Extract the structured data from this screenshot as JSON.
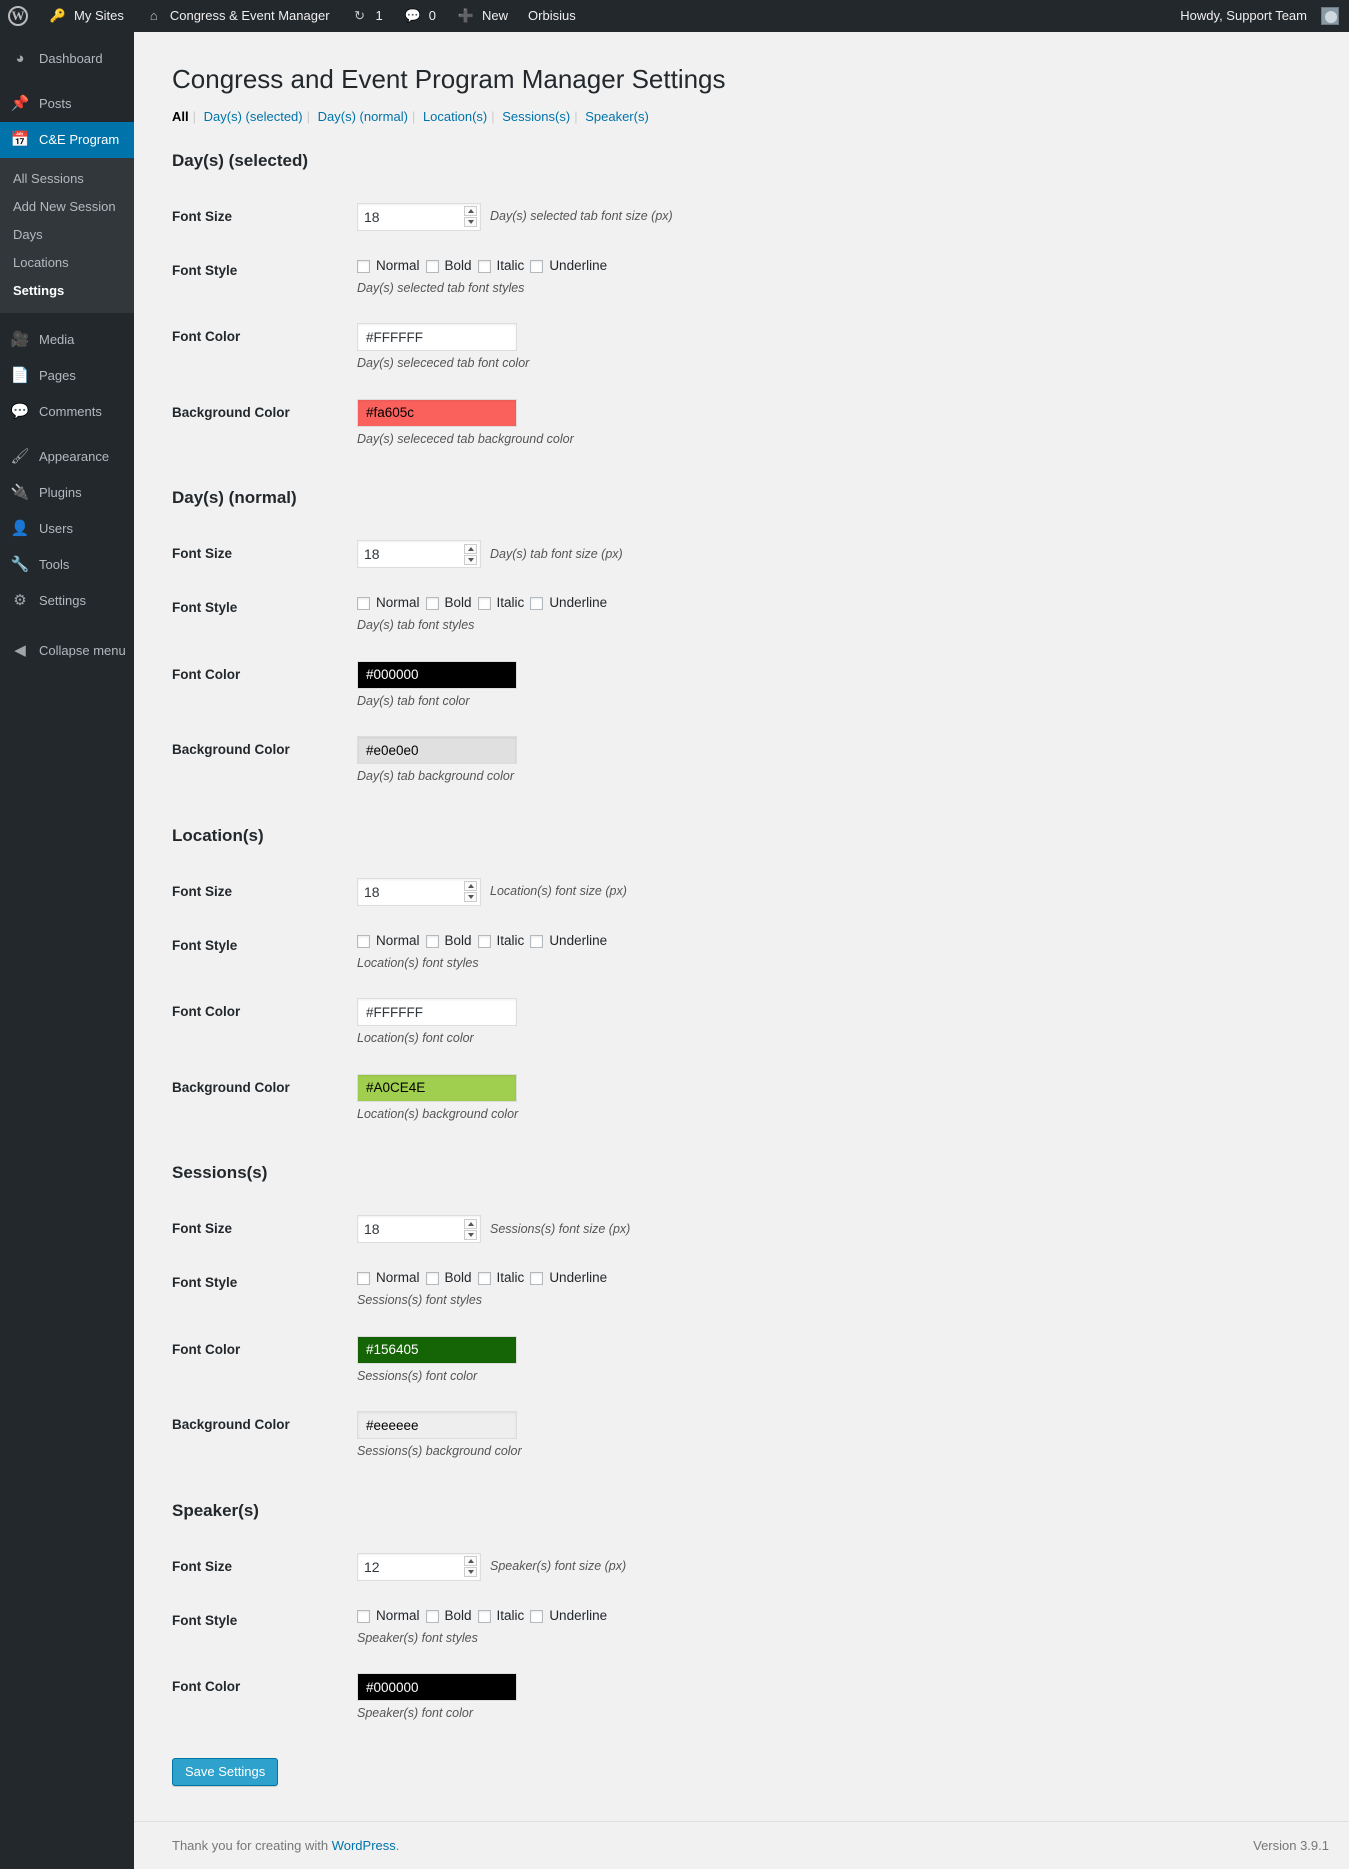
{
  "adminbar": {
    "logo_icon": "wordpress-logo-icon",
    "items": [
      {
        "icon": "key-icon",
        "label": "My Sites"
      },
      {
        "icon": "home-icon",
        "label": "Congress & Event Manager"
      },
      {
        "icon": "updates-icon",
        "label": "1"
      },
      {
        "icon": "comment-bubble-icon",
        "label": "0"
      },
      {
        "icon": "plus-icon",
        "label": "New"
      },
      {
        "icon": "",
        "label": "Orbisius"
      }
    ],
    "howdy": "Howdy, Support Team"
  },
  "sidebar": {
    "items": [
      {
        "icon": "dashboard-icon",
        "label": "Dashboard",
        "current": false
      },
      {
        "icon": "pin-icon",
        "label": "Posts",
        "current": false
      },
      {
        "icon": "calendar-icon",
        "label": "C&E Program",
        "current": true
      },
      {
        "icon": "media-icon",
        "label": "Media",
        "current": false
      },
      {
        "icon": "pages-icon",
        "label": "Pages",
        "current": false
      },
      {
        "icon": "comments-icon",
        "label": "Comments",
        "current": false
      },
      {
        "icon": "appearance-icon",
        "label": "Appearance",
        "current": false
      },
      {
        "icon": "plugins-icon",
        "label": "Plugins",
        "current": false
      },
      {
        "icon": "users-icon",
        "label": "Users",
        "current": false
      },
      {
        "icon": "tools-icon",
        "label": "Tools",
        "current": false
      },
      {
        "icon": "settings-icon",
        "label": "Settings",
        "current": false
      },
      {
        "icon": "collapse-icon",
        "label": "Collapse menu",
        "current": false
      }
    ],
    "submenu": [
      {
        "label": "All Sessions",
        "current": false
      },
      {
        "label": "Add New Session",
        "current": false
      },
      {
        "label": "Days",
        "current": false
      },
      {
        "label": "Locations",
        "current": false
      },
      {
        "label": "Settings",
        "current": true
      }
    ]
  },
  "page": {
    "title": "Congress and Event Program Manager Settings",
    "filters": [
      {
        "label": "All",
        "current": true
      },
      {
        "label": "Day(s) (selected)",
        "current": false
      },
      {
        "label": "Day(s) (normal)",
        "current": false
      },
      {
        "label": "Location(s)",
        "current": false
      },
      {
        "label": "Sessions(s)",
        "current": false
      },
      {
        "label": "Speaker(s)",
        "current": false
      }
    ],
    "save_label": "Save Settings"
  },
  "labels": {
    "font_size": "Font Size",
    "font_style": "Font Style",
    "font_color": "Font Color",
    "background_color": "Background Color",
    "styles": [
      "Normal",
      "Bold",
      "Italic",
      "Underline"
    ]
  },
  "sections": [
    {
      "title": "Day(s) (selected)",
      "font_size": {
        "value": "18",
        "desc": "Day(s) selected tab font size (px)"
      },
      "font_style": {
        "desc": "Day(s) selected tab font styles",
        "checked": [
          false,
          false,
          false,
          false
        ]
      },
      "font_color": {
        "value": "#FFFFFF",
        "desc": "Day(s) selececed tab font color",
        "bg": "#ffffff",
        "fg": "#32373c"
      },
      "background_color": {
        "value": "#fa605c",
        "desc": "Day(s) selececed tab background color",
        "bg": "#fa605c",
        "fg": "#000000"
      }
    },
    {
      "title": "Day(s) (normal)",
      "font_size": {
        "value": "18",
        "desc": "Day(s) tab font size (px)"
      },
      "font_style": {
        "desc": "Day(s) tab font styles",
        "checked": [
          false,
          false,
          false,
          false
        ]
      },
      "font_color": {
        "value": "#000000",
        "desc": "Day(s) tab font color",
        "bg": "#000000",
        "fg": "#ffffff"
      },
      "background_color": {
        "value": "#e0e0e0",
        "desc": "Day(s) tab background color",
        "bg": "#e0e0e0",
        "fg": "#000000"
      }
    },
    {
      "title": "Location(s)",
      "font_size": {
        "value": "18",
        "desc": "Location(s) font size (px)"
      },
      "font_style": {
        "desc": "Location(s) font styles",
        "checked": [
          false,
          false,
          false,
          false
        ]
      },
      "font_color": {
        "value": "#FFFFFF",
        "desc": "Location(s) font color",
        "bg": "#ffffff",
        "fg": "#32373c"
      },
      "background_color": {
        "value": "#A0CE4E",
        "desc": "Location(s) background color",
        "bg": "#a0ce4e",
        "fg": "#000000"
      }
    },
    {
      "title": "Sessions(s)",
      "font_size": {
        "value": "18",
        "desc": "Sessions(s) font size (px)"
      },
      "font_style": {
        "desc": "Sessions(s) font styles",
        "checked": [
          false,
          false,
          false,
          false
        ]
      },
      "font_color": {
        "value": "#156405",
        "desc": "Sessions(s) font color",
        "bg": "#156405",
        "fg": "#ffffff"
      },
      "background_color": {
        "value": "#eeeeee",
        "desc": "Sessions(s) background color",
        "bg": "#eeeeee",
        "fg": "#000000"
      }
    },
    {
      "title": "Speaker(s)",
      "font_size": {
        "value": "12",
        "desc": "Speaker(s) font size (px)"
      },
      "font_style": {
        "desc": "Speaker(s) font styles",
        "checked": [
          false,
          false,
          false,
          false
        ]
      },
      "font_color": {
        "value": "#000000",
        "desc": "Speaker(s) font color",
        "bg": "#000000",
        "fg": "#ffffff"
      },
      "background_color": null
    }
  ],
  "footer": {
    "thanks_prefix": "Thank you for creating with ",
    "thanks_link": "WordPress",
    "thanks_suffix": ".",
    "version": "Version 3.9.1"
  },
  "colors": {
    "accent": "#0073aa",
    "adminbar_bg": "#23282d",
    "link": "#0073aa",
    "button": "#2ea2cc"
  }
}
